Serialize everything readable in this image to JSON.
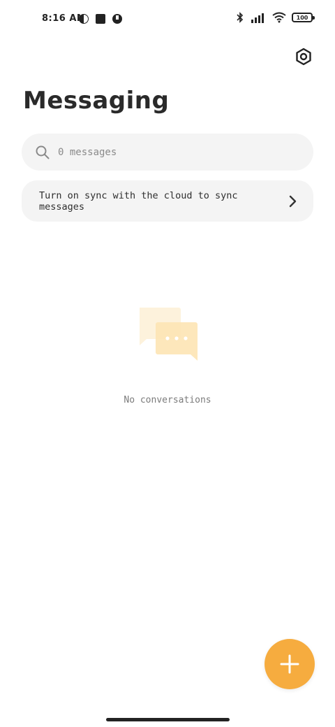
{
  "status_bar": {
    "time": "8:16 AM",
    "battery": "100",
    "icons": [
      "notification-icon",
      "stop-icon",
      "notification-icon",
      "bluetooth-icon",
      "signal-icon",
      "wifi-icon",
      "battery-icon"
    ]
  },
  "header": {
    "title": "Messaging",
    "settings_icon": "settings-icon"
  },
  "search": {
    "placeholder": "0 messages"
  },
  "sync_banner": {
    "text": "Turn on sync with the cloud to sync messages"
  },
  "empty_state": {
    "text": "No conversations"
  },
  "colors": {
    "accent": "#f6ac3f",
    "card_bg": "#f4f4f4",
    "illustration_light": "#fdf2dc",
    "illustration_mid": "#fde4b4"
  }
}
